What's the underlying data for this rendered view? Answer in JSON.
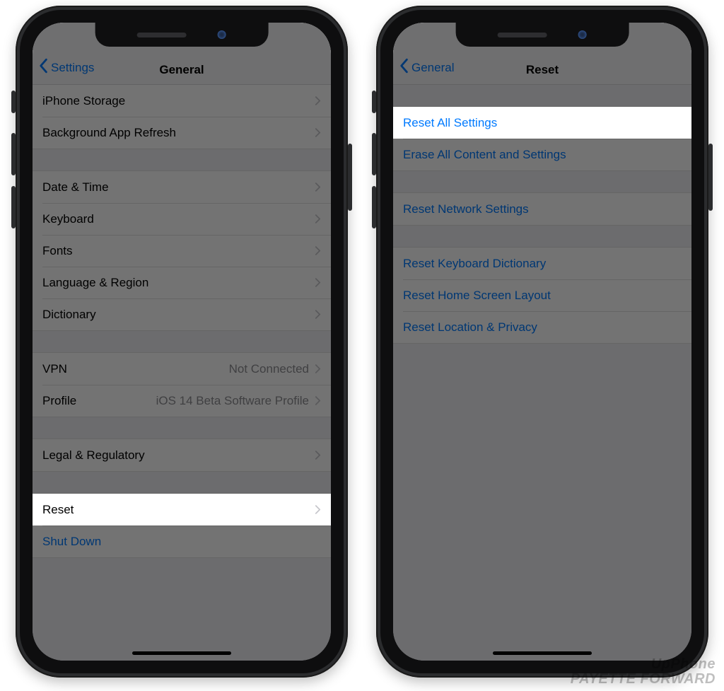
{
  "watermark": {
    "line1": "UpPhone",
    "line2": "PAYETTE FORWARD"
  },
  "colors": {
    "accent": "#007aff",
    "secondary": "#8e8e93",
    "bg": "#efeff4"
  },
  "phone_left": {
    "nav": {
      "back_label": "Settings",
      "title": "General"
    },
    "groups": [
      {
        "rows": [
          {
            "label": "iPhone Storage",
            "chevron": true
          },
          {
            "label": "Background App Refresh",
            "chevron": true
          }
        ]
      },
      {
        "rows": [
          {
            "label": "Date & Time",
            "chevron": true
          },
          {
            "label": "Keyboard",
            "chevron": true
          },
          {
            "label": "Fonts",
            "chevron": true
          },
          {
            "label": "Language & Region",
            "chevron": true
          },
          {
            "label": "Dictionary",
            "chevron": true
          }
        ]
      },
      {
        "rows": [
          {
            "label": "VPN",
            "detail": "Not Connected",
            "chevron": true
          },
          {
            "label": "Profile",
            "detail": "iOS 14 Beta Software Profile",
            "chevron": true
          }
        ]
      },
      {
        "rows": [
          {
            "label": "Legal & Regulatory",
            "chevron": true
          }
        ]
      },
      {
        "rows": [
          {
            "label": "Reset",
            "chevron": true,
            "highlight": true
          },
          {
            "label": "Shut Down",
            "link": true
          }
        ]
      }
    ]
  },
  "phone_right": {
    "nav": {
      "back_label": "General",
      "title": "Reset"
    },
    "groups": [
      {
        "rows": [
          {
            "label": "Reset All Settings",
            "link": true,
            "highlight": true
          },
          {
            "label": "Erase All Content and Settings",
            "link": true
          }
        ]
      },
      {
        "rows": [
          {
            "label": "Reset Network Settings",
            "link": true
          }
        ]
      },
      {
        "rows": [
          {
            "label": "Reset Keyboard Dictionary",
            "link": true
          },
          {
            "label": "Reset Home Screen Layout",
            "link": true
          },
          {
            "label": "Reset Location & Privacy",
            "link": true
          }
        ]
      }
    ]
  }
}
